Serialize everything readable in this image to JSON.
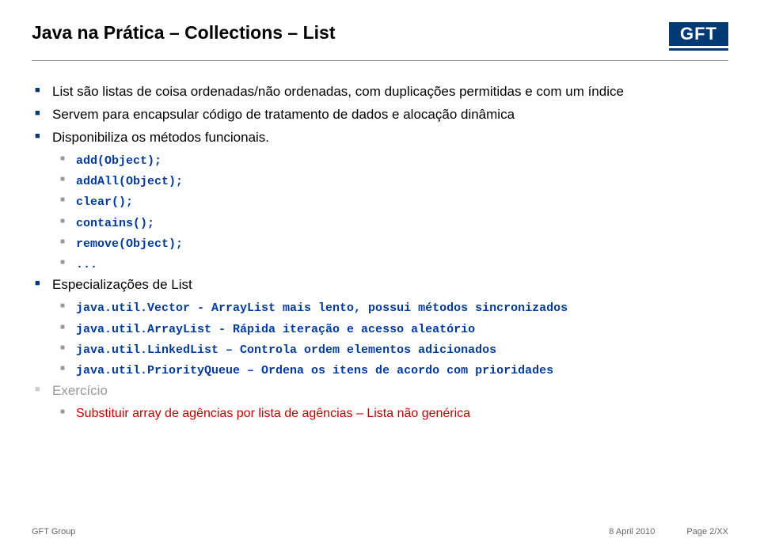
{
  "header": {
    "title": "Java na Prática – Collections – List",
    "logo": "GFT"
  },
  "bullets": {
    "b1": "List são listas de coisa ordenadas/não ordenadas, com duplicações permitidas e com um índice",
    "b2": "Servem para encapsular código de tratamento de dados e alocação dinâmica",
    "b3": "Disponibiliza os métodos funcionais.",
    "methods": {
      "m1": "add(Object);",
      "m2": "addAll(Object);",
      "m3": "clear();",
      "m4": "contains();",
      "m5": "remove(Object);",
      "m6": "..."
    },
    "b4": "Especializações de List",
    "specs": {
      "s1": "java.util.Vector - ArrayList mais lento, possui métodos sincronizados",
      "s2": "java.util.ArrayList - Rápida iteração e acesso aleatório",
      "s3": "java.util.LinkedList – Controla ordem elementos adicionados",
      "s4": "java.util.PriorityQueue – Ordena os itens de acordo com prioridades"
    },
    "b5": "Exercício",
    "ex1": "Substituir array de agências por lista de agências – Lista não genérica"
  },
  "footer": {
    "left": "GFT Group",
    "date": "8 April 2010",
    "page": "Page 2/XX"
  }
}
